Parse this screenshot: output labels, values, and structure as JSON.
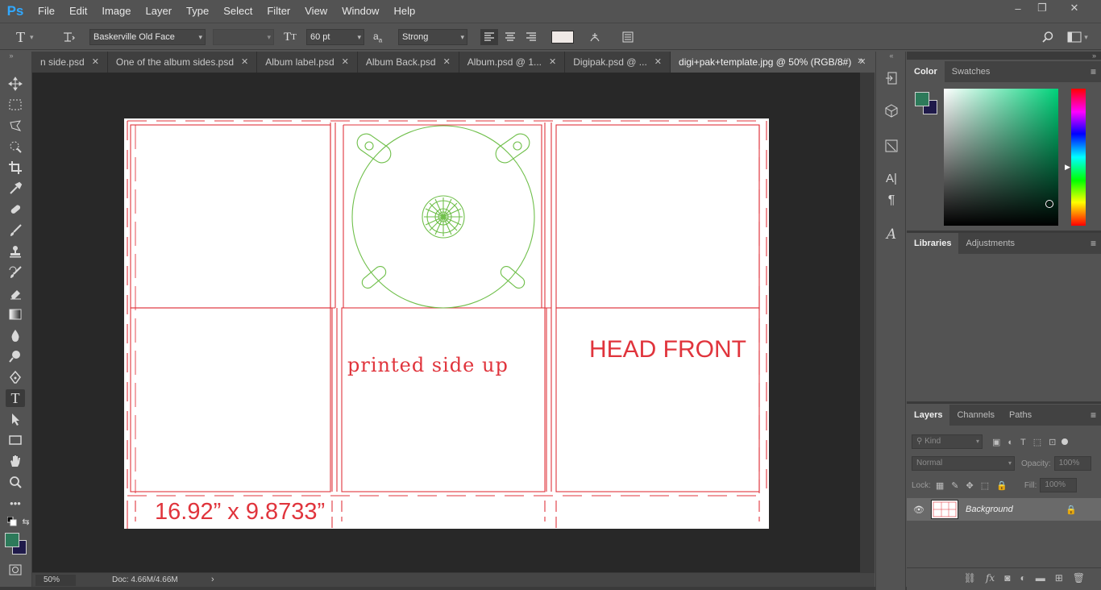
{
  "app": {
    "logo": "Ps"
  },
  "menu": [
    "File",
    "Edit",
    "Image",
    "Layer",
    "Type",
    "Select",
    "Filter",
    "View",
    "Window",
    "Help"
  ],
  "window_controls": {
    "minimize": "–",
    "restore": "❐",
    "close": "✕"
  },
  "options": {
    "font_family": "Baskerville Old Face",
    "font_style": "",
    "font_size": "60 pt",
    "antialias_icon_label": "a",
    "antialias": "Strong",
    "text_color": "#efe9e6"
  },
  "tabs": [
    {
      "label": "n side.psd",
      "close": "✕",
      "active": false
    },
    {
      "label": "One of the album sides.psd",
      "close": "✕",
      "active": false
    },
    {
      "label": "Album label.psd",
      "close": "✕",
      "active": false
    },
    {
      "label": "Album Back.psd",
      "close": "✕",
      "active": false
    },
    {
      "label": "Album.psd @ 1...",
      "close": "✕",
      "active": false
    },
    {
      "label": "Digipak.psd @ ...",
      "close": "✕",
      "active": false
    },
    {
      "label": "digi+pak+template.jpg @ 50% (RGB/8#)",
      "close": "✕",
      "active": true
    }
  ],
  "tabs_more": "»",
  "document": {
    "text_printed": "printed  side  up",
    "text_head": "HEAD FRONT",
    "text_dims": "16.92” x 9.8733”",
    "template_red": "#e0343c",
    "disc_green": "#6fbf4a"
  },
  "status": {
    "zoom": "50%",
    "doc": "Doc: 4.66M/4.66M",
    "arrow": "›"
  },
  "color_panel": {
    "tabs": [
      "Color",
      "Swatches"
    ],
    "foreground": "#2d7a5a",
    "background": "#1f1a4a"
  },
  "libraries_panel": {
    "tabs": [
      "Libraries",
      "Adjustments"
    ]
  },
  "layers_panel": {
    "tabs": [
      "Layers",
      "Channels",
      "Paths"
    ],
    "filter_placeholder": "Kind",
    "blend_mode": "Normal",
    "opacity_label": "Opacity:",
    "opacity_value": "100%",
    "lock_label": "Lock:",
    "fill_label": "Fill:",
    "fill_value": "100%",
    "layers": [
      {
        "name": "Background",
        "visible": true,
        "locked": true
      }
    ]
  },
  "panel_menu_icon": "≡"
}
